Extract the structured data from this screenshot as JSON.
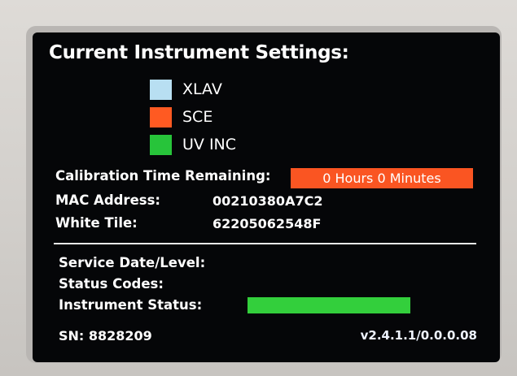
{
  "title": "Current Instrument Settings:",
  "legend": [
    {
      "label": "XLAV",
      "color": "#b8dff2"
    },
    {
      "label": "SCE",
      "color": "#ff5a22"
    },
    {
      "label": "UV INC",
      "color": "#27c43a"
    }
  ],
  "calibration": {
    "label": "Calibration Time Remaining:",
    "value": "0 Hours 0 Minutes",
    "color": "#fa5522"
  },
  "mac": {
    "label": "MAC Address:",
    "value": "00210380A7C2"
  },
  "white_tile": {
    "label": "White Tile:",
    "value": "62205062548F"
  },
  "service": {
    "label": "Service Date/Level:",
    "value": ""
  },
  "status_codes": {
    "label": "Status Codes:",
    "value": ""
  },
  "instrument_status": {
    "label": "Instrument Status:",
    "level": 1.0,
    "color": "#33cf3c"
  },
  "footer": {
    "sn": "SN: 8828209",
    "version": "v2.4.1.1/0.0.0.08"
  }
}
